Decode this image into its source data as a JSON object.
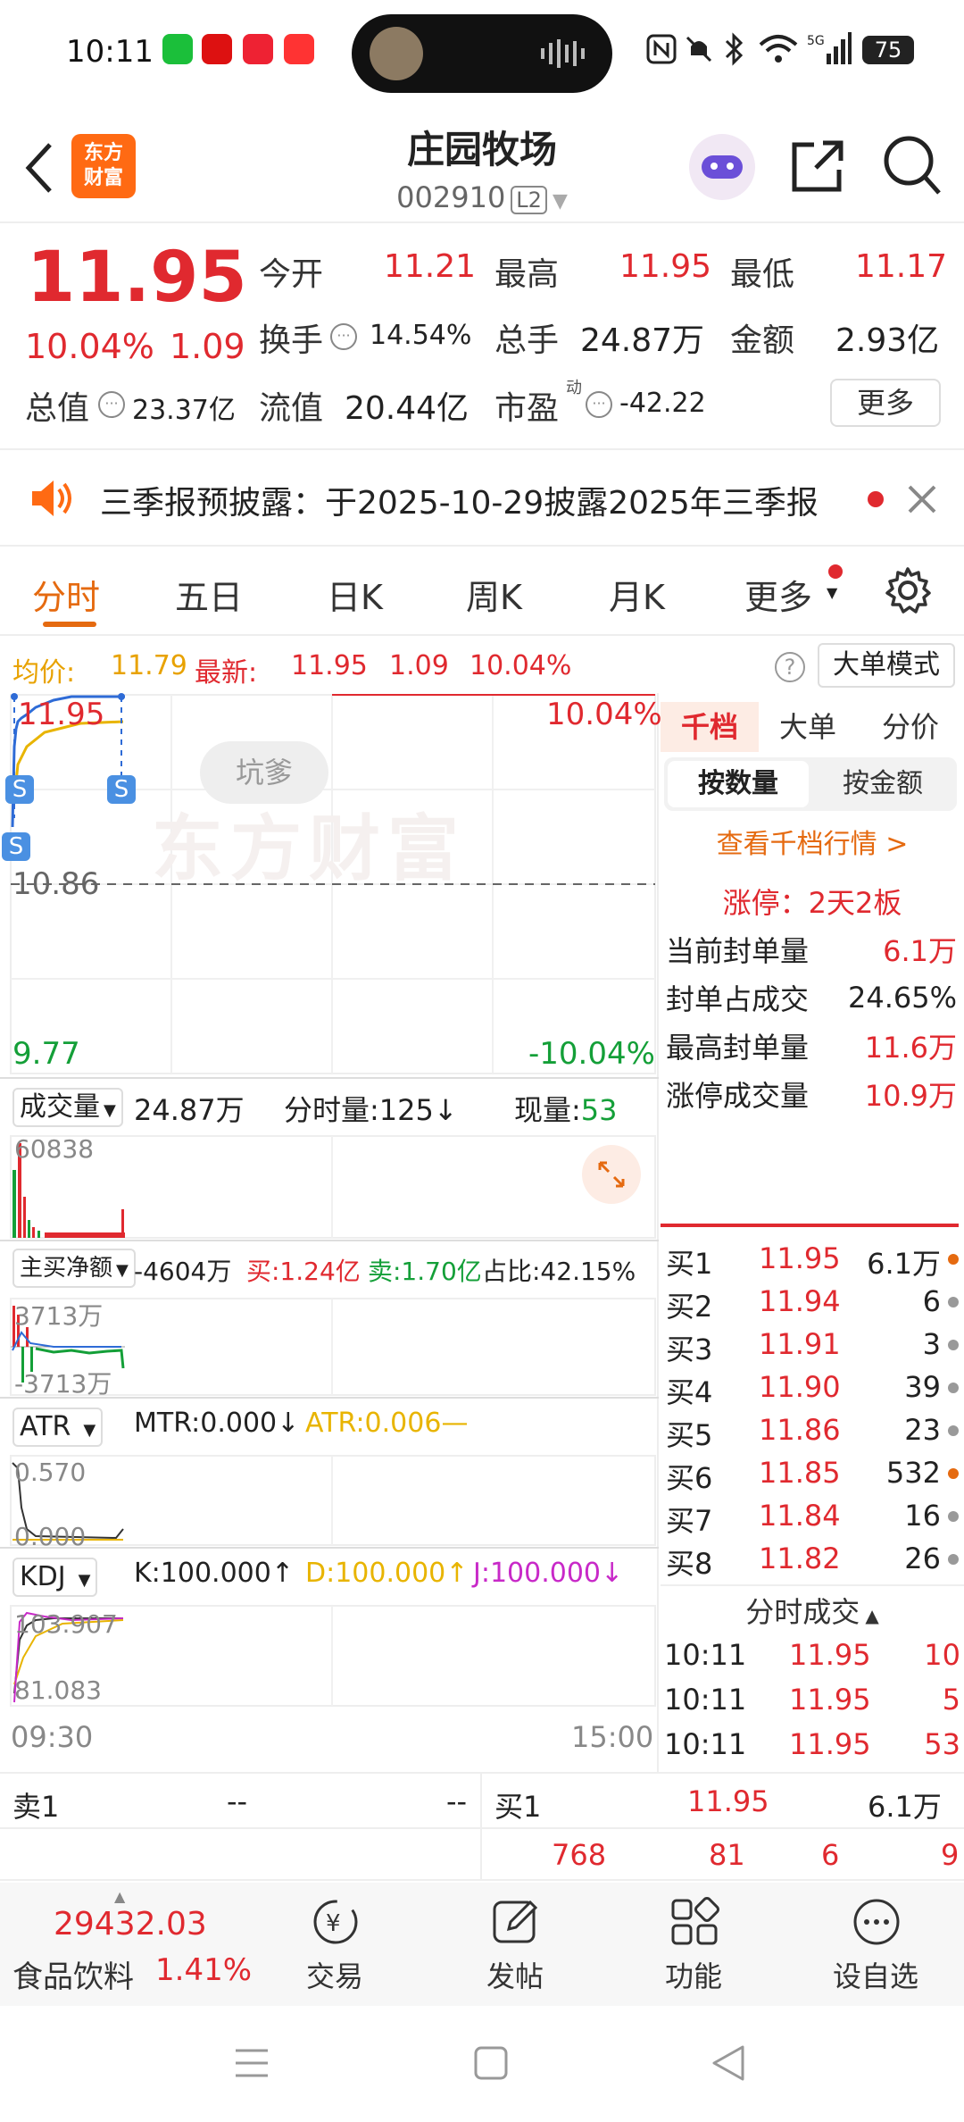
{
  "status": {
    "time": "10:11",
    "battery": "75"
  },
  "header": {
    "title": "庄园牧场",
    "code": "002910",
    "level": "L2",
    "logo_line1": "东方",
    "logo_line2": "财富"
  },
  "quote": {
    "price": "11.95",
    "pct": "10.04%",
    "change": "1.09",
    "open_label": "今开",
    "open": "11.21",
    "high_label": "最高",
    "high": "11.95",
    "low_label": "最低",
    "low": "11.17",
    "turnover_label": "换手",
    "turnover": "14.54%",
    "volume_label": "总手",
    "volume": "24.87万",
    "amount_label": "金额",
    "amount": "2.93亿",
    "mktcap_label": "总值",
    "mktcap": "23.37亿",
    "float_label": "流值",
    "float": "20.44亿",
    "pe_label": "市盈",
    "pe_sup": "动",
    "pe": "-42.22",
    "more_label": "更多"
  },
  "notice": {
    "text": "三季报预披露：于2025-10-29披露2025年三季报"
  },
  "tabs": [
    "分时",
    "五日",
    "日K",
    "周K",
    "月K",
    "更多"
  ],
  "avg": {
    "avg_label": "均价:",
    "avg": "11.79",
    "last_label": "最新:",
    "last": "11.95",
    "chg": "1.09",
    "pct": "10.04%",
    "mode_label": "大单模式"
  },
  "chart": {
    "top_price": "11.95",
    "top_pct": "10.04%",
    "mid_price": "10.86",
    "bot_price": "9.77",
    "bot_pct": "-10.04%",
    "watermark": "东方财富",
    "bubble": "坑爹",
    "s_marker": "S",
    "vol_label": "成交量",
    "vol_total": "24.87万",
    "vol_min": "分时量:125",
    "vol_min_arrow": "↓",
    "vol_now_label": "现量:",
    "vol_now": "53",
    "vol_max": "60838",
    "flow_label": "主买净额",
    "flow_val": "-4604万",
    "flow_buy": "买:1.24亿",
    "flow_sell": "卖:1.70亿",
    "flow_ratio": "占比:42.15%",
    "flow_top": "3713万",
    "flow_bot": "-3713万",
    "atr_label": "ATR",
    "mtr": "MTR:0.000",
    "mtr_arrow": "↓",
    "atr": "ATR:0.006",
    "atr_top": "0.570",
    "atr_bot": "0.000",
    "kdj_label": "KDJ",
    "k": "K:100.000",
    "k_arrow": "↑",
    "d": "D:100.000",
    "d_arrow": "↑",
    "j": "J:100.000",
    "j_arrow": "↓",
    "kdj_top": "103.907",
    "kdj_bot": "81.083",
    "t_start": "09:30",
    "t_end": "15:00"
  },
  "side": {
    "tabs": [
      "千档",
      "大单",
      "分价"
    ],
    "sub_tabs": [
      "按数量",
      "按金额"
    ],
    "link": "查看千档行情 >",
    "limit": "涨停：2天2板",
    "stats": [
      {
        "label": "当前封单量",
        "value": "6.1万"
      },
      {
        "label": "封单占成交",
        "value": "24.65%"
      },
      {
        "label": "最高封单量",
        "value": "11.6万"
      },
      {
        "label": "涨停成交量",
        "value": "10.9万"
      }
    ],
    "bids": [
      {
        "label": "买1",
        "price": "11.95",
        "vol": "6.1万",
        "dot": "#e56a10"
      },
      {
        "label": "买2",
        "price": "11.94",
        "vol": "6",
        "dot": "#999"
      },
      {
        "label": "买3",
        "price": "11.91",
        "vol": "3",
        "dot": "#999"
      },
      {
        "label": "买4",
        "price": "11.90",
        "vol": "39",
        "dot": "#999"
      },
      {
        "label": "买5",
        "price": "11.86",
        "vol": "23",
        "dot": "#999"
      },
      {
        "label": "买6",
        "price": "11.85",
        "vol": "532",
        "dot": "#e56a10"
      },
      {
        "label": "买7",
        "price": "11.84",
        "vol": "16",
        "dot": "#999"
      },
      {
        "label": "买8",
        "price": "11.82",
        "vol": "26",
        "dot": "#999"
      }
    ],
    "ticks_label": "分时成交",
    "ticks": [
      {
        "time": "10:11",
        "price": "11.95",
        "vol": "10"
      },
      {
        "time": "10:11",
        "price": "11.95",
        "vol": "5"
      },
      {
        "time": "10:11",
        "price": "11.95",
        "vol": "53"
      }
    ]
  },
  "bottom": {
    "ask_label": "卖1",
    "ask_price": "--",
    "ask_vol": "--",
    "bid_label": "买1",
    "bid_price": "11.95",
    "bid_vol": "6.1万",
    "queue": [
      "768",
      "81",
      "6",
      "9"
    ]
  },
  "tabbar": {
    "index_value": "29432.03",
    "index_name": "食品饮料",
    "index_pct": "1.41%",
    "items": [
      "交易",
      "发帖",
      "功能",
      "设自选"
    ]
  }
}
